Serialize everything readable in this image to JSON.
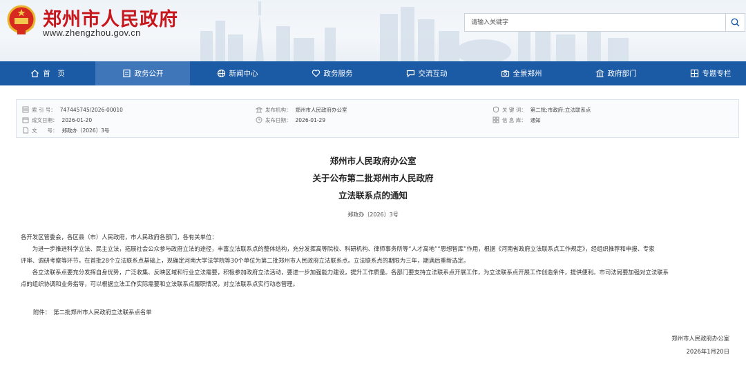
{
  "header": {
    "site_title": "郑州市人民政府",
    "site_url": "www.zhengzhou.gov.cn",
    "search_placeholder": "请输入关键字"
  },
  "nav": {
    "items": [
      {
        "label": "首　页",
        "icon": "home-icon"
      },
      {
        "label": "政务公开",
        "icon": "document-icon"
      },
      {
        "label": "新闻中心",
        "icon": "globe-icon"
      },
      {
        "label": "政务服务",
        "icon": "heart-icon"
      },
      {
        "label": "交流互动",
        "icon": "chat-icon"
      },
      {
        "label": "全景郑州",
        "icon": "camera-icon"
      },
      {
        "label": "政府部门",
        "icon": "building-icon"
      },
      {
        "label": "专题专栏",
        "icon": "columns-icon"
      }
    ],
    "active_index": 1
  },
  "meta": {
    "index_label": "索 引 号：",
    "index_value": "747445745/2026-00010",
    "date_label": "成文日期：",
    "date_value": "2026-01-20",
    "docno_label": "文　　号：",
    "docno_value": "郑政办〔2026〕3号",
    "issuer_label": "发布机构：",
    "issuer_value": "郑州市人民政府办公室",
    "pubdate_label": "发布日期：",
    "pubdate_value": "2026-01-29",
    "keywords_label": "关 键 词：",
    "keywords_value": "第二批;市政府;立法联系点",
    "category_label": "信 息 库：",
    "category_value": "通知"
  },
  "doc": {
    "title_line1": "郑州市人民政府办公室",
    "title_line2": "关于公布第二批郑州市人民政府",
    "title_line3": "立法联系点的通知",
    "number": "郑政办〔2026〕3号",
    "salutation": "各开发区管委会，各区县（市）人民政府，市人民政府各部门，各有关单位：",
    "para1_l1": "为进一步推进科学立法、民主立法，拓展社会公众参与政府立法的途径，丰富立法联系点的整体结构，充分发挥高等院校、科研机构、律师事务所等“人才高地”“思想智库”作用，根据《河南省政府立法联系点工作规定》，经组织推荐和申报、专家",
    "para1_l2": "评审、调研考察等环节，在首批28个立法联系点基础上，现确定河南大学法学院等30个单位为第二批郑州市人民政府立法联系点。立法联系点的期限为三年，期满后重新选定。",
    "para2_l1": "各立法联系点要充分发挥自身优势，广泛收集、反映区域和行业立法需要，积极参加政府立法活动，要进一步加强能力建设，提升工作质量。各部门要支持立法联系点开展工作，为立法联系点开展工作创造条件，提供便利。市司法局要加强对立法联系",
    "para2_l2": "点的组织协调和业务指导，可以根据立法工作实际需要和立法联系点履职情况，对立法联系点实行动态管理。",
    "attachment": "附件：　第二批郑州市人民政府立法联系点名单",
    "signer": "郑州市人民政府办公室",
    "sign_date": "2026年1月20日"
  },
  "colors": {
    "brand_red": "#c8161d",
    "nav_blue": "#1b5aa5",
    "nav_active": "#3f76b9"
  }
}
